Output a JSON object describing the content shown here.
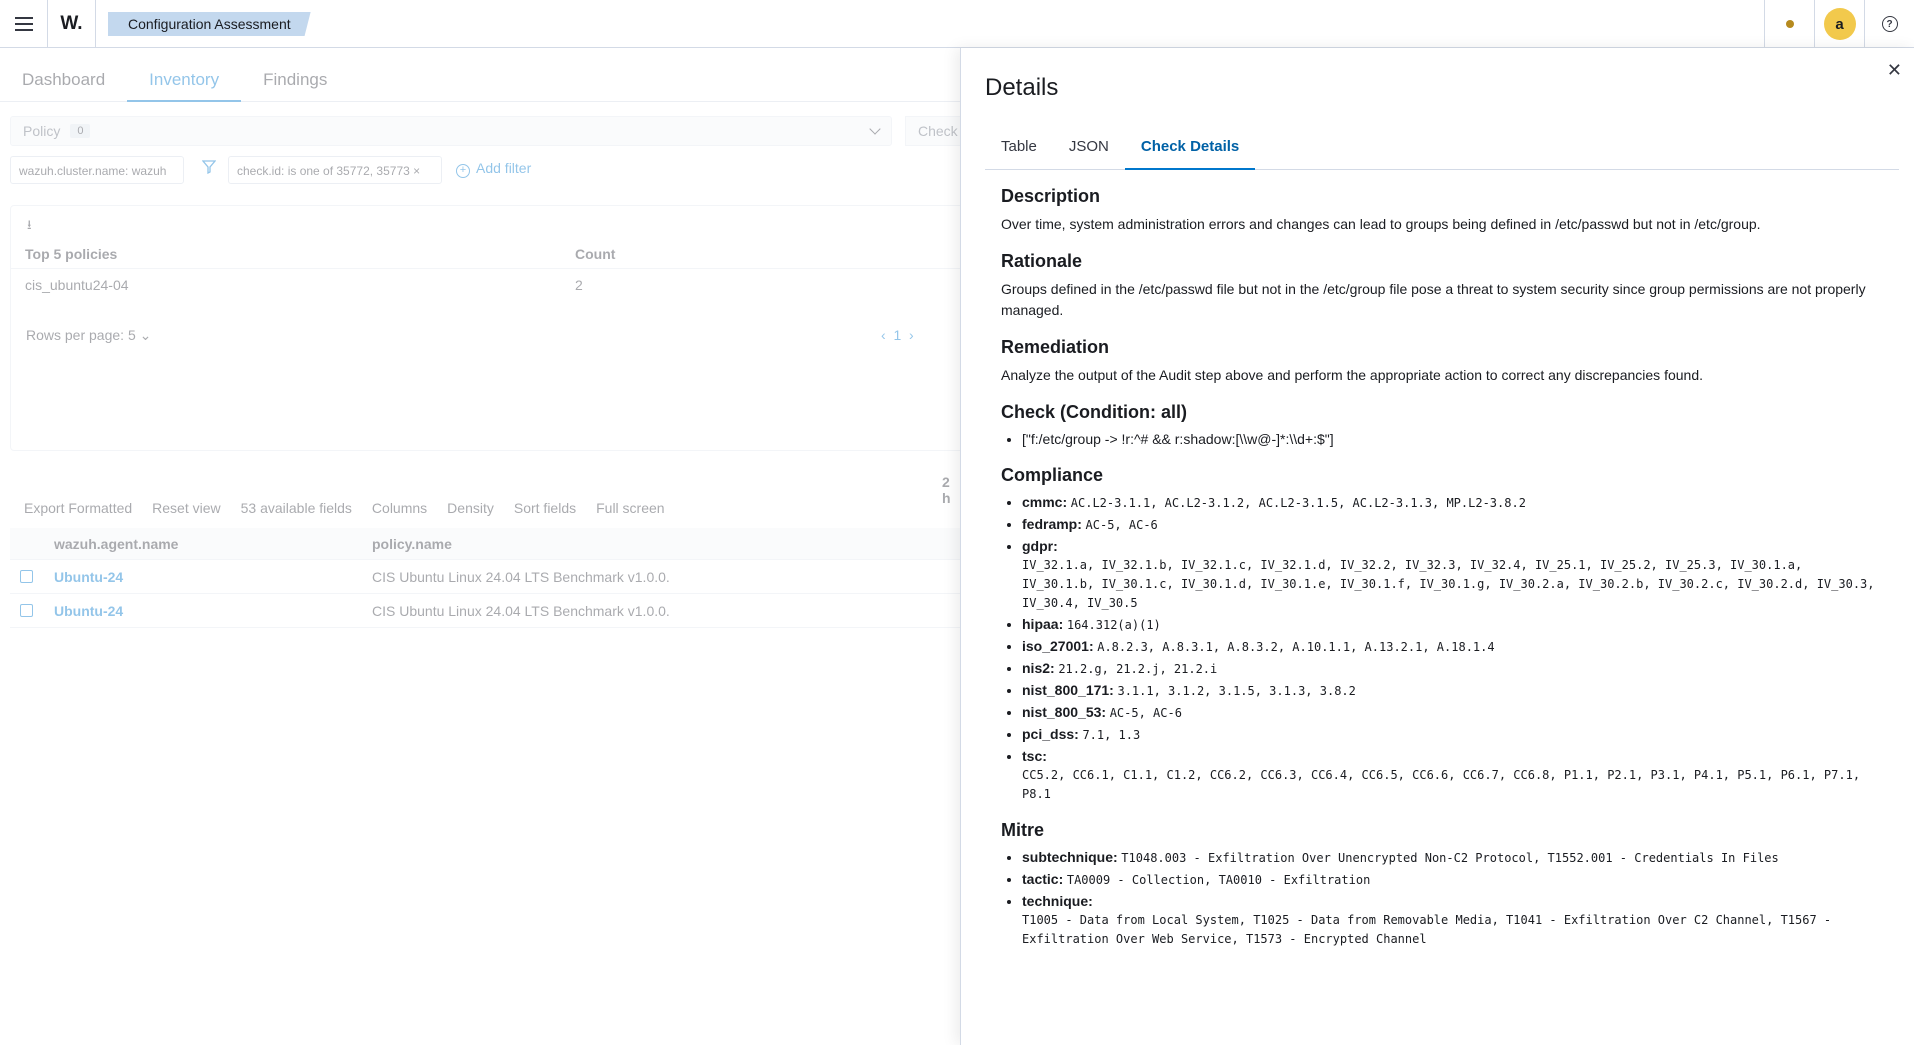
{
  "header": {
    "logo": "W.",
    "breadcrumb": "Configuration Assessment",
    "avatar_initial": "a",
    "help": "?"
  },
  "background": {
    "tabs": [
      "Dashboard",
      "Inventory",
      "Findings"
    ],
    "policy_label": "Policy",
    "policy_count": "0",
    "check_label": "Check",
    "filter_cluster": "wazuh.cluster.name: wazuh",
    "filter_check": "check.id: is one of 35772, 35773",
    "add_filter": "Add filter",
    "table_headers": [
      "Top 5 policies",
      "Count"
    ],
    "table_row": [
      "cis_ubuntu24-04",
      "2"
    ],
    "rows_per_page": "Rows per page: 5",
    "page": "1",
    "hits": "2 h",
    "toolbar": [
      "Export Formatted",
      "Reset view",
      "53 available fields",
      "Columns",
      "Density",
      "Sort fields",
      "Full screen"
    ],
    "grid_headers": [
      "wazuh.agent.name",
      "policy.name"
    ],
    "grid_rows": [
      {
        "agent": "Ubuntu-24",
        "policy": "CIS Ubuntu Linux 24.04 LTS Benchmark v1.0.0."
      },
      {
        "agent": "Ubuntu-24",
        "policy": "CIS Ubuntu Linux 24.04 LTS Benchmark v1.0.0."
      }
    ]
  },
  "flyout": {
    "title": "Details",
    "tabs": [
      "Table",
      "JSON",
      "Check Details"
    ],
    "selected_tab": "Check Details",
    "description_h": "Description",
    "description": "Over time, system administration errors and changes can lead to groups being defined in /etc/passwd but not in /etc/group.",
    "rationale_h": "Rationale",
    "rationale": "Groups defined in the /etc/passwd file but not in the /etc/group file pose a threat to system security since group permissions are not properly managed.",
    "remediation_h": "Remediation",
    "remediation": "Analyze the output of the Audit step above and perform the appropriate action to correct any discrepancies found.",
    "check_h": "Check (Condition: all)",
    "check_rule": "[\"f:/etc/group -> !r:^# && r:shadow:[\\\\w@-]*:\\\\d+:$\"]",
    "compliance_h": "Compliance",
    "compliance": [
      {
        "k": "cmmc:",
        "v": "AC.L2-3.1.1, AC.L2-3.1.2, AC.L2-3.1.5, AC.L2-3.1.3, MP.L2-3.8.2"
      },
      {
        "k": "fedramp:",
        "v": "AC-5, AC-6"
      },
      {
        "k": "gdpr:",
        "v": "IV_32.1.a, IV_32.1.b, IV_32.1.c, IV_32.1.d, IV_32.2, IV_32.3, IV_32.4, IV_25.1, IV_25.2, IV_25.3, IV_30.1.a, IV_30.1.b, IV_30.1.c, IV_30.1.d, IV_30.1.e, IV_30.1.f, IV_30.1.g, IV_30.2.a, IV_30.2.b, IV_30.2.c, IV_30.2.d, IV_30.3, IV_30.4, IV_30.5"
      },
      {
        "k": "hipaa:",
        "v": "164.312(a)(1)"
      },
      {
        "k": "iso_27001:",
        "v": "A.8.2.3, A.8.3.1, A.8.3.2, A.10.1.1, A.13.2.1, A.18.1.4"
      },
      {
        "k": "nis2:",
        "v": "21.2.g, 21.2.j, 21.2.i"
      },
      {
        "k": "nist_800_171:",
        "v": "3.1.1, 3.1.2, 3.1.5, 3.1.3, 3.8.2"
      },
      {
        "k": "nist_800_53:",
        "v": "AC-5, AC-6"
      },
      {
        "k": "pci_dss:",
        "v": "7.1, 1.3"
      },
      {
        "k": "tsc:",
        "v": "CC5.2, CC6.1, C1.1, C1.2, CC6.2, CC6.3, CC6.4, CC6.5, CC6.6, CC6.7, CC6.8, P1.1, P2.1, P3.1, P4.1, P5.1, P6.1, P7.1, P8.1"
      }
    ],
    "mitre_h": "Mitre",
    "mitre": [
      {
        "k": "subtechnique:",
        "v": "T1048.003 - Exfiltration Over Unencrypted Non-C2 Protocol, T1552.001 - Credentials In Files"
      },
      {
        "k": "tactic:",
        "v": "TA0009 - Collection, TA0010 - Exfiltration"
      },
      {
        "k": "technique:",
        "v": "T1005 - Data from Local System, T1025 - Data from Removable Media, T1041 - Exfiltration Over C2 Channel, T1567 - Exfiltration Over Web Service, T1573 - Encrypted Channel"
      }
    ]
  }
}
